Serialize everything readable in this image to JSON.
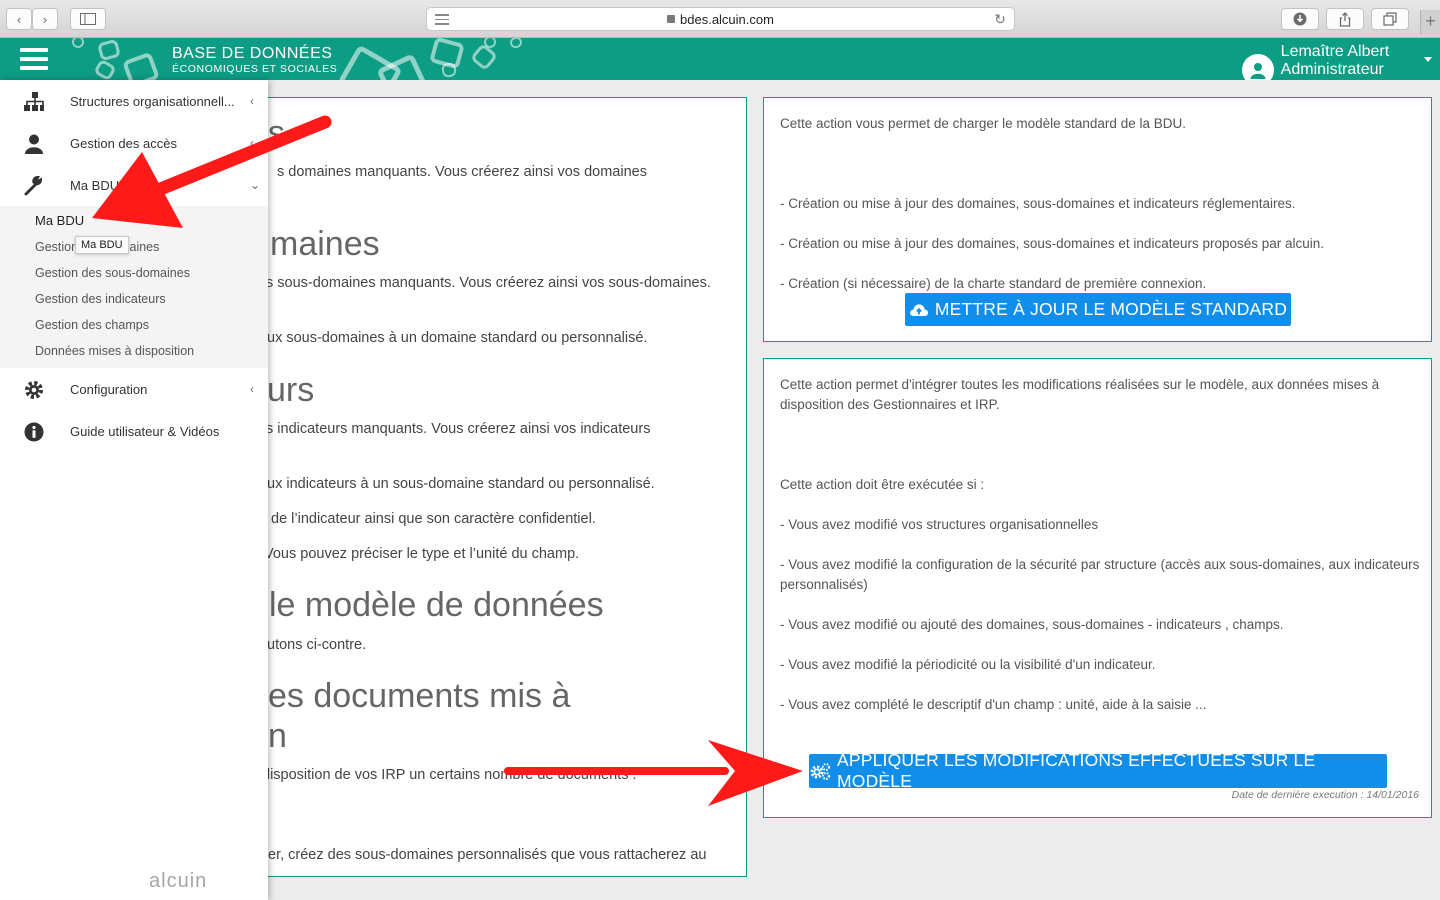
{
  "browser": {
    "url": "bdes.alcuin.com"
  },
  "header": {
    "brand_line1": "BASE DE DONNÉES",
    "brand_line2": "ÉCONOMIQUES ET SOCIALES",
    "user_name": "Lemaître Albert",
    "user_role": "Administrateur Groupe",
    "accent_color": "#0d9c84"
  },
  "sidebar": {
    "items": [
      {
        "label": "Structures organisationnell...",
        "icon": "sitemap-icon"
      },
      {
        "label": "Gestion des accès",
        "icon": "user-icon"
      },
      {
        "label": "Ma BDU",
        "icon": "wrench-icon"
      },
      {
        "label": "Configuration",
        "icon": "gear-icon"
      },
      {
        "label": "Guide utilisateur & Vidéos",
        "icon": "info-icon"
      }
    ],
    "submenu": [
      "Ma BDU",
      "Gestion des domaines",
      "Gestion des sous-domaines",
      "Gestion des indicateurs",
      "Gestion des champs",
      "Données mises à disposition"
    ],
    "tooltip": "Ma BDU",
    "logo": "alcuin"
  },
  "left_panel": {
    "lines": [
      {
        "kind": "heading",
        "text": "es"
      },
      {
        "kind": "text",
        "text": "s domaines manquants. Vous créerez ainsi vos domaines"
      },
      {
        "kind": "heading",
        "text": "maines"
      },
      {
        "kind": "text",
        "text": "s sous-domaines manquants. Vous créerez ainsi vos sous-domaines."
      },
      {
        "kind": "text",
        "text": "ux sous-domaines à un domaine standard ou personnalisé."
      },
      {
        "kind": "heading",
        "text": "urs"
      },
      {
        "kind": "text",
        "text": "s indicateurs manquants. Vous créerez ainsi vos indicateurs"
      },
      {
        "kind": "text",
        "text": "ux indicateurs à un sous-domaine standard ou personnalisé."
      },
      {
        "kind": "text",
        "text": "de l’indicateur ainsi que son caractère confidentiel."
      },
      {
        "kind": "text",
        "text": "Vous pouvez préciser le type et l’unité du champ."
      },
      {
        "kind": "heading",
        "text": "le modèle de données"
      },
      {
        "kind": "text",
        "text": "utons ci-contre."
      },
      {
        "kind": "heading",
        "text": "es documents mis à"
      },
      {
        "kind": "heading",
        "text": "n"
      },
      {
        "kind": "text",
        "text": "disposition de vos IRP un certains nombre de documents :"
      },
      {
        "kind": "text",
        "text": "er, créez des sous-domaines personnalisés que vous rattacherez au"
      }
    ]
  },
  "standard_box": {
    "intro": "Cette action vous permet de charger le modèle standard de la BDU.",
    "bullets": [
      "- Création ou mise à jour des domaines, sous-domaines et indicateurs réglementaires.",
      "- Création ou mise à jour des domaines, sous-domaines et indicateurs proposés par alcuin.",
      "- Création (si nécessaire) de la charte standard de première connexion."
    ],
    "button_label": "METTRE À JOUR LE MODÈLE STANDARD",
    "button_icon": "cloud-upload-icon"
  },
  "apply_box": {
    "intro": "Cette action permet d'intégrer toutes les modifications réalisées sur le modèle, aux données mises à disposition des Gestionnaires et IRP.",
    "condition": "Cette action doit être exécutée si :",
    "bullets": [
      "- Vous avez modifié vos structures organisationnelles",
      "- Vous avez modifié la configuration de la sécurité par structure (accès aux sous-domaines, aux indicateurs personnalisés)",
      "- Vous avez modifié ou ajouté des domaines, sous-domaines - indicateurs , champs.",
      "- Vous avez modifié la périodicité ou la visibilité d'un indicateur.",
      "- Vous avez complété le descriptif d'un champ : unité, aide à la saisie ..."
    ],
    "button_label": "APPLIQUER LES MODIFICATIONS EFFECTUÉES SUR LE MODÈLE",
    "button_icon": "cogs-icon",
    "last_exec": "Date de dernière execution : 14/01/2016"
  },
  "colors": {
    "button_blue": "#108ee9",
    "arrow_red": "#ff1a1a"
  }
}
